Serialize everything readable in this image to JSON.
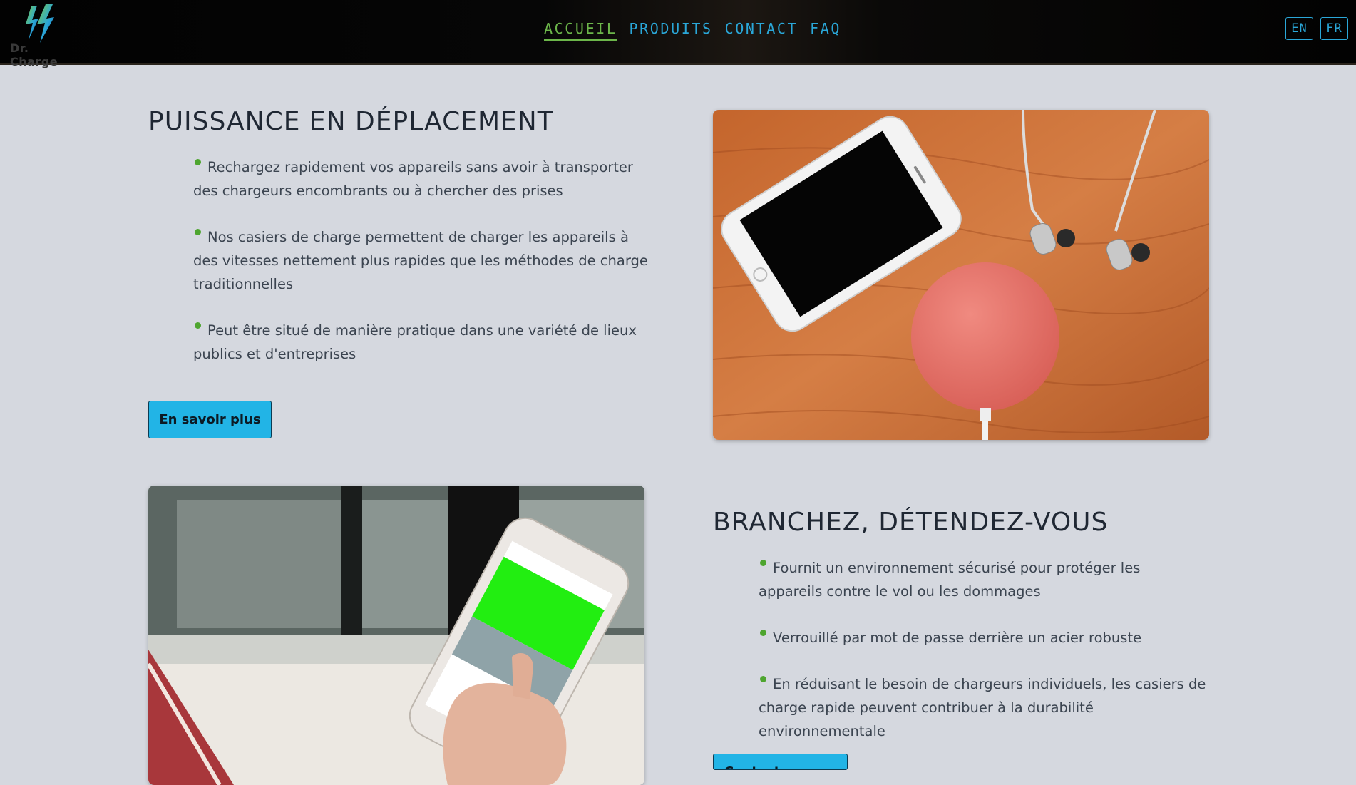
{
  "header": {
    "logo_text": "Dr. Charge",
    "nav": [
      {
        "label": "ACCUEIL",
        "active": true
      },
      {
        "label": "PRODUITS",
        "active": false
      },
      {
        "label": "CONTACT",
        "active": false
      },
      {
        "label": "FAQ",
        "active": false
      }
    ],
    "languages": [
      "EN",
      "FR"
    ]
  },
  "section1": {
    "title": "PUISSANCE EN DÉPLACEMENT",
    "features": [
      "Rechargez rapidement vos appareils sans avoir à transporter des chargeurs encombrants ou à chercher des prises",
      "Nos casiers de charge permettent de charger les appareils à des vitesses nettement plus rapides que les méthodes de charge traditionnelles",
      "Peut être situé de manière pratique dans une variété de lieux publics et d'entreprises"
    ],
    "button_label": "En savoir plus"
  },
  "section2": {
    "title": "BRANCHEZ, DÉTENDEZ-VOUS",
    "features": [
      "Fournit un environnement sécurisé pour protéger les appareils contre le vol ou les dommages",
      "Verrouillé par mot de passe derrière un acier robuste",
      "En réduisant le besoin de chargeurs individuels, les casiers de charge rapide peuvent contribuer à la durabilité environnementale"
    ],
    "button_label": "Contactez-nous"
  },
  "colors": {
    "accent_blue": "#22b4e6",
    "active_green": "#6cb64a",
    "bullet_green": "#4ea52f",
    "background": "#d5d8df"
  }
}
